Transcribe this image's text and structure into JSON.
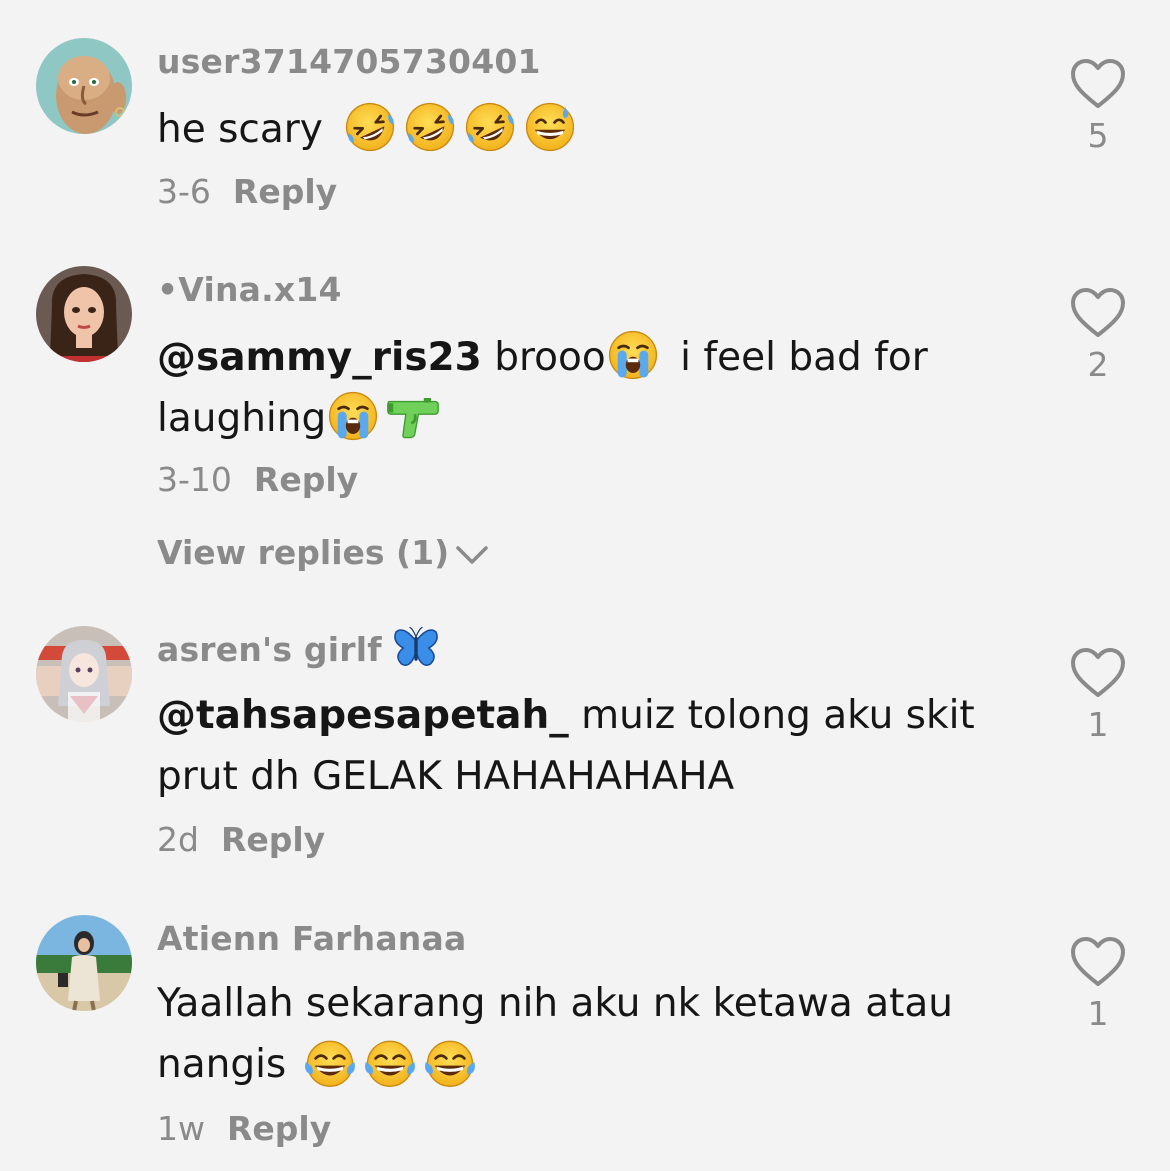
{
  "comments": [
    {
      "username": "user3714705730401",
      "body_text": "he scary",
      "emojis": [
        "rofl-emoji",
        "rofl-emoji",
        "rofl-emoji",
        "grinning-sweat-emoji"
      ],
      "time": "3-6",
      "reply_label": "Reply",
      "likes": "5"
    },
    {
      "username": "•Vina.x14",
      "mention": "@sammy_ris23",
      "text_part1": "brooo",
      "text_part2": "i feel bad for",
      "text_part3": "laughing",
      "emojis": [
        "loudly-crying-emoji",
        "loudly-crying-emoji",
        "water-pistol-emoji"
      ],
      "time": "3-10",
      "reply_label": "Reply",
      "view_replies_label": "View replies (1)",
      "likes": "2"
    },
    {
      "username": "asren's girlf",
      "username_emoji": "blue-butterfly-emoji",
      "mention": "@tahsapesapetah_",
      "text_part1": "muiz tolong aku skit",
      "text_part2": "prut dh GELAK HAHAHAHAHA",
      "time": "2d",
      "reply_label": "Reply",
      "likes": "1"
    },
    {
      "username": "Atienn Farhanaa",
      "text_part1": "Yaallah sekarang nih aku nk ketawa atau",
      "text_part2": "nangis",
      "emojis": [
        "tears-of-joy-emoji",
        "tears-of-joy-emoji",
        "tears-of-joy-emoji"
      ],
      "time": "1w",
      "reply_label": "Reply",
      "likes": "1"
    }
  ],
  "colors": {
    "background": "#f3f3f3",
    "secondary_text": "#8a8a8a",
    "primary_text": "#161616",
    "emoji_yellow": "#f7c531",
    "tear_blue": "#5aa9ef",
    "water_pistol_green": "#6fd05a",
    "butterfly_blue": "#3b8ee8"
  }
}
